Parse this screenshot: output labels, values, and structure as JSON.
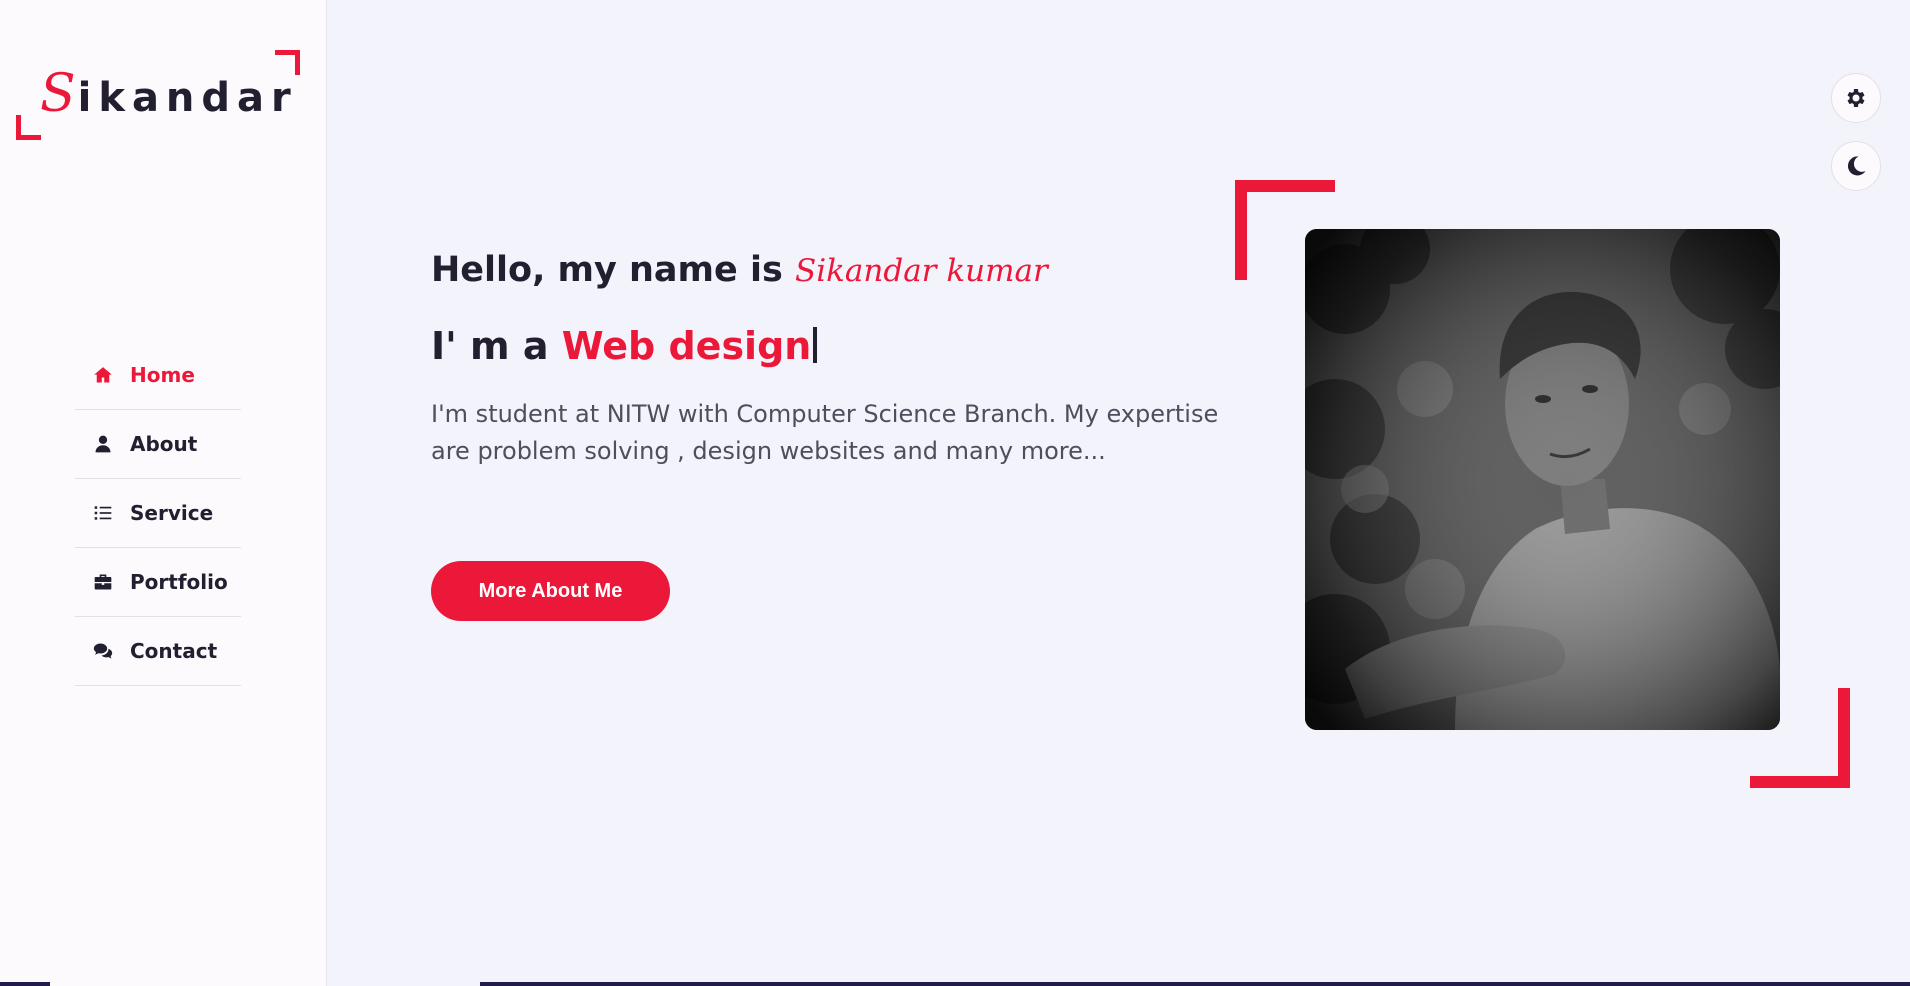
{
  "logo": {
    "initial": "S",
    "rest": "ikandar"
  },
  "nav": {
    "items": [
      {
        "label": "Home",
        "icon": "home-icon",
        "active": true
      },
      {
        "label": "About",
        "icon": "user-icon",
        "active": false
      },
      {
        "label": "Service",
        "icon": "list-icon",
        "active": false
      },
      {
        "label": "Portfolio",
        "icon": "briefcase-icon",
        "active": false
      },
      {
        "label": "Contact",
        "icon": "comments-icon",
        "active": false
      }
    ]
  },
  "hero": {
    "greeting": "Hello, my name is ",
    "name": "Sikandar kumar",
    "role_prefix": "I' m a ",
    "role_typed": "Web design",
    "description": "I'm student at NITW with Computer Science Branch. My expertise are problem solving , design websites and many more...",
    "button_label": "More About Me"
  },
  "photo": {
    "description_icon": "profile-photo"
  },
  "controls": {
    "settings_icon": "gear-icon",
    "theme_icon": "moon-icon"
  },
  "colors": {
    "accent": "#ec1839",
    "text": "#222030",
    "background": "#f2f3fb",
    "sidebar": "#fdfafd"
  }
}
